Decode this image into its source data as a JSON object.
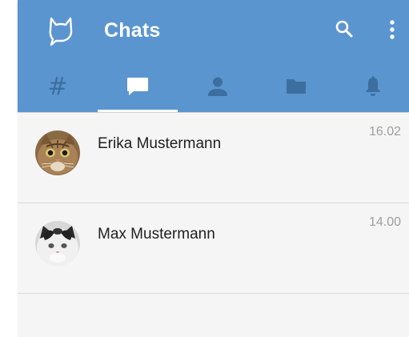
{
  "appbar": {
    "title": "Chats",
    "logo_icon": "cat-speech-bubble-icon",
    "actions": [
      {
        "icon": "search-icon"
      },
      {
        "icon": "more-vert-icon"
      }
    ],
    "background_color": "#5b95cf"
  },
  "tabs": [
    {
      "label": "#",
      "icon": "hash-icon",
      "active": false
    },
    {
      "icon": "chat-bubble-icon",
      "active": true
    },
    {
      "icon": "person-icon",
      "active": false
    },
    {
      "icon": "folder-icon",
      "active": false
    },
    {
      "icon": "bell-icon",
      "active": false
    }
  ],
  "colors": {
    "active_tab": "#ffffff",
    "inactive_tab": "#3c6f9f",
    "list_background": "#f5f5f5",
    "divider": "#d9d9d9",
    "timestamp": "#9e9e9e"
  },
  "chats": [
    {
      "name": "Erika Mustermann",
      "time": "16.02",
      "avatar": "tabby-cat-avatar"
    },
    {
      "name": "Max Mustermann",
      "time": "14.00",
      "avatar": "white-cat-avatar"
    }
  ]
}
